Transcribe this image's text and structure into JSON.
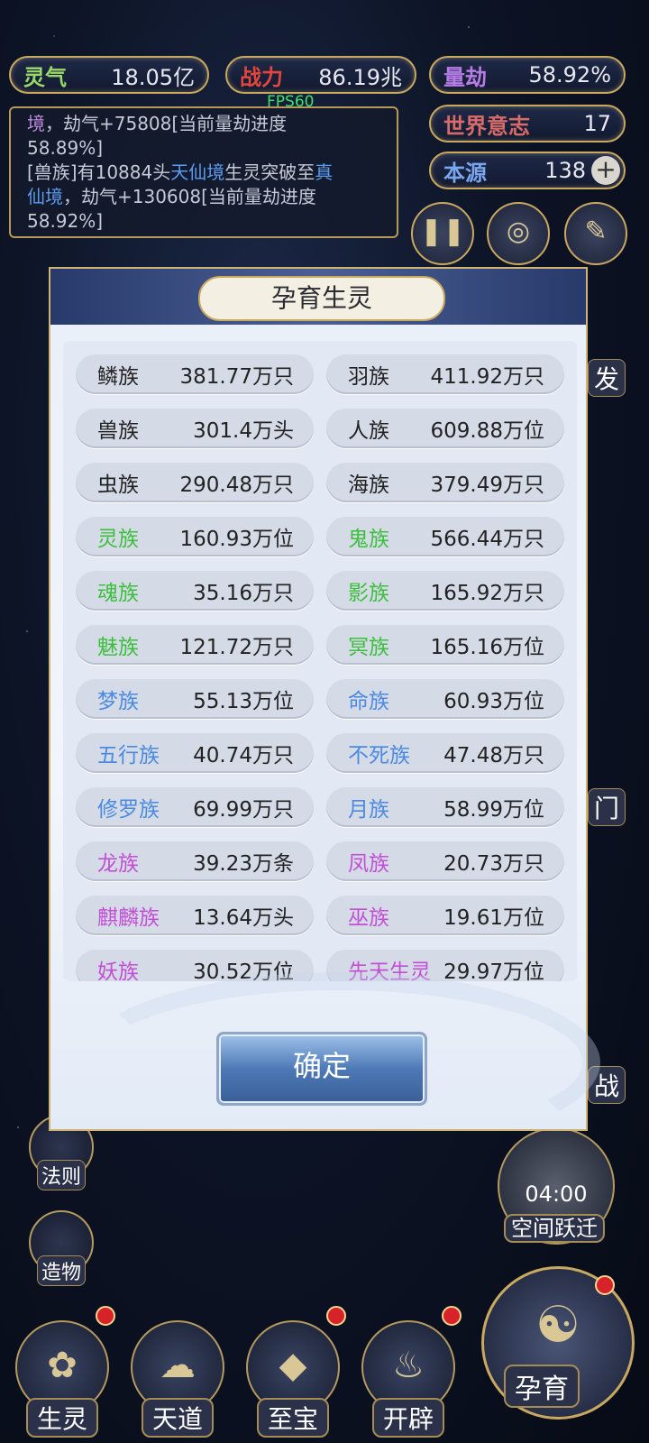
{
  "stats": {
    "lingqi": {
      "label": "灵气",
      "value": "18.05亿",
      "color": "#9bd86a"
    },
    "zhanli": {
      "label": "战力",
      "value": "86.19兆",
      "color": "#e3463c"
    },
    "liangjie": {
      "label": "量劫",
      "value": "58.92%",
      "color": "#b77de6"
    },
    "shijie": {
      "label": "世界意志",
      "value": "17",
      "color": "#d86a6a"
    },
    "benyuan": {
      "label": "本源",
      "value": "138",
      "color": "#7aa6f0"
    }
  },
  "fps": "FPS60",
  "log": {
    "line1_a": "境",
    "line1_b": "，劫气+75808[当前量劫进度",
    "line2": "58.89%]",
    "line3_a": "[兽族]有10884头",
    "line3_b": "天仙境",
    "line3_c": "生灵突破至",
    "line3_d": "真",
    "line4_a": "仙境",
    "line4_b": "，劫气+130608[当前量劫进度",
    "line5": "58.92%]"
  },
  "dialog": {
    "title": "孕育生灵",
    "confirm": "确定",
    "races": [
      {
        "name": "鳞族",
        "count": "381.77万只",
        "color": "#222222"
      },
      {
        "name": "羽族",
        "count": "411.92万只",
        "color": "#222222"
      },
      {
        "name": "兽族",
        "count": "301.4万头",
        "color": "#222222"
      },
      {
        "name": "人族",
        "count": "609.88万位",
        "color": "#222222"
      },
      {
        "name": "虫族",
        "count": "290.48万只",
        "color": "#222222"
      },
      {
        "name": "海族",
        "count": "379.49万只",
        "color": "#222222"
      },
      {
        "name": "灵族",
        "count": "160.93万位",
        "color": "#3cbf3c"
      },
      {
        "name": "鬼族",
        "count": "566.44万只",
        "color": "#3cbf3c"
      },
      {
        "name": "魂族",
        "count": "35.16万只",
        "color": "#3cbf3c"
      },
      {
        "name": "影族",
        "count": "165.92万只",
        "color": "#3cbf3c"
      },
      {
        "name": "魅族",
        "count": "121.72万只",
        "color": "#3cbf3c"
      },
      {
        "name": "冥族",
        "count": "165.16万位",
        "color": "#3cbf3c"
      },
      {
        "name": "梦族",
        "count": "55.13万位",
        "color": "#4a8ae0"
      },
      {
        "name": "命族",
        "count": "60.93万位",
        "color": "#4a8ae0"
      },
      {
        "name": "五行族",
        "count": "40.74万只",
        "color": "#4a8ae0"
      },
      {
        "name": "不死族",
        "count": "47.48万只",
        "color": "#4a8ae0"
      },
      {
        "name": "修罗族",
        "count": "69.99万只",
        "color": "#4a8ae0"
      },
      {
        "name": "月族",
        "count": "58.99万位",
        "color": "#4a8ae0"
      },
      {
        "name": "龙族",
        "count": "39.23万条",
        "color": "#c24fd6"
      },
      {
        "name": "凤族",
        "count": "20.73万只",
        "color": "#c24fd6"
      },
      {
        "name": "麒麟族",
        "count": "13.64万头",
        "color": "#c24fd6"
      },
      {
        "name": "巫族",
        "count": "19.61万位",
        "color": "#c24fd6"
      },
      {
        "name": "妖族",
        "count": "30.52万位",
        "color": "#c24fd6"
      },
      {
        "name": "先天生灵",
        "count": "29.97万位",
        "color": "#c24fd6"
      }
    ]
  },
  "side": {
    "right_partial_fa": "发",
    "right_partial_men": "门",
    "right_partial_zhan": "战",
    "left_fa": "法则",
    "left_zao": "造物",
    "timer": "04:00",
    "jump": "空间跃迁"
  },
  "bottom": {
    "shengling": "生灵",
    "tiandao": "天道",
    "zhibao": "至宝",
    "kaipi": "开辟",
    "yunyu": "孕育"
  }
}
